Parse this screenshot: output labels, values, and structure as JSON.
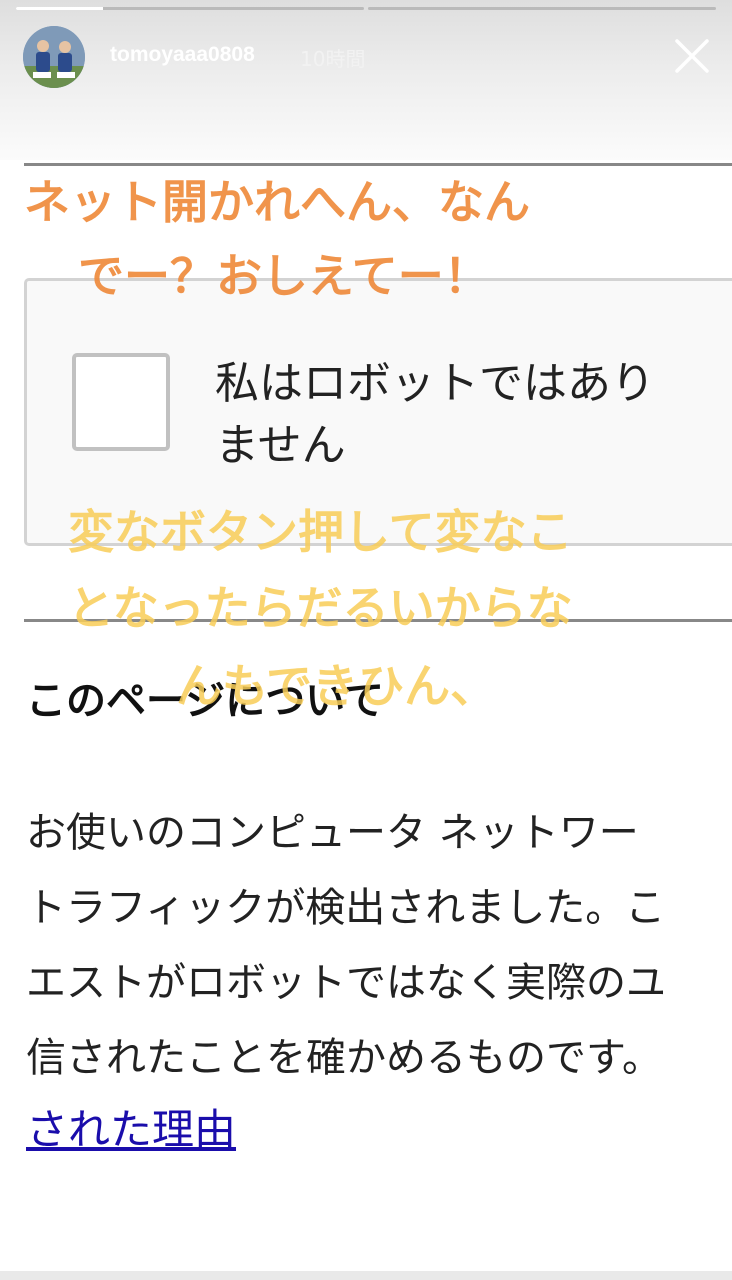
{
  "story": {
    "username": "tomoyaaa0808",
    "timestamp": "10時間",
    "progress": [
      0.25,
      0
    ],
    "close_icon": "close-icon"
  },
  "captcha": {
    "checkbox_label": "私はロボットではあり",
    "checkbox_label_line2": "ません",
    "checked": false
  },
  "about": {
    "heading": "このページについて",
    "lines": [
      "お使いのコンピュータ ネットワー",
      "トラフィックが検出されました。こ",
      "エストがロボットではなく実際のユ",
      "信されたことを確かめるものです。"
    ],
    "link": "された理由"
  },
  "overlay": {
    "orange_lines": [
      "ネット開かれへん、なん",
      "でー？おしえてー！"
    ],
    "yellow_lines": [
      "変なボタン押して変なこ",
      "となったらだるいからな",
      "んもできひん、"
    ],
    "orange_color": "#ef8c3e",
    "yellow_color": "#f8cd58"
  }
}
